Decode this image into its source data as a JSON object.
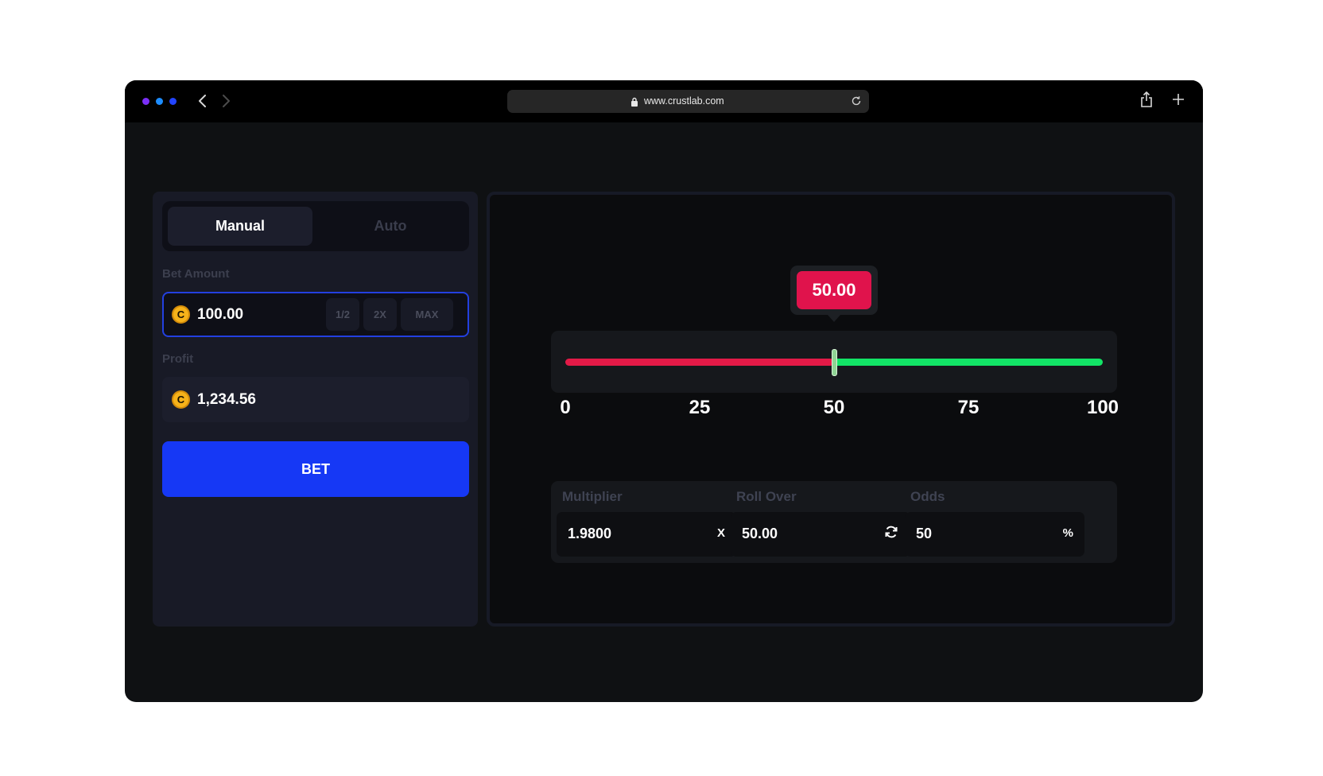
{
  "browser": {
    "url": "www.crustlab.com"
  },
  "tabs": {
    "manual": "Manual",
    "auto": "Auto"
  },
  "bet": {
    "label": "Bet Amount",
    "amount": "100.00",
    "coin_symbol": "C",
    "half": "1/2",
    "double": "2X",
    "max": "MAX"
  },
  "profit": {
    "label": "Profit",
    "amount": "1,234.56"
  },
  "bet_button": "BET",
  "slider": {
    "value_label": "50.00",
    "value": 50,
    "min": 0,
    "max": 100,
    "ticks": [
      "0",
      "25",
      "50",
      "75",
      "100"
    ],
    "colors": {
      "under": "#e31a47",
      "over": "#12e466"
    }
  },
  "stats": {
    "multiplier": {
      "label": "Multiplier",
      "value": "1.9800",
      "suffix": "X"
    },
    "roll_over": {
      "label": "Roll Over",
      "value": "50.00",
      "icon": "swap-icon"
    },
    "odds": {
      "label": "Odds",
      "value": "50",
      "suffix": "%"
    }
  }
}
